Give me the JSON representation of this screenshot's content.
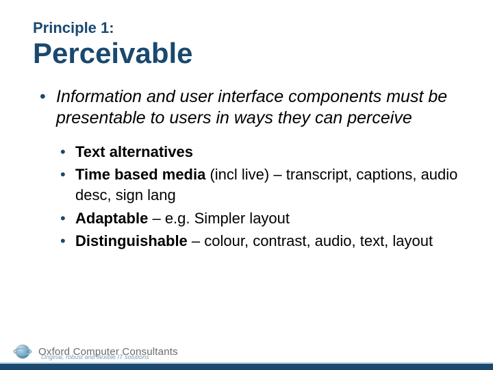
{
  "kicker": "Principle 1:",
  "title": "Perceivable",
  "main_point": "Information and user interface components must be presentable to users in ways they can perceive",
  "sub_points": [
    {
      "lead": "Text alternatives",
      "rest": ""
    },
    {
      "lead": "Time based media",
      "rest": " (incl live) – transcript, captions, audio desc, sign lang"
    },
    {
      "lead": "Adaptable",
      "rest": " – e.g. Simpler layout"
    },
    {
      "lead": "Distinguishable",
      "rest": " – colour, contrast, audio, text, layout"
    }
  ],
  "brand": {
    "name": "Oxford Computer Consultants",
    "tagline": "Original, robust and flexible IT solutions"
  },
  "colors": {
    "accent": "#1a486f"
  }
}
